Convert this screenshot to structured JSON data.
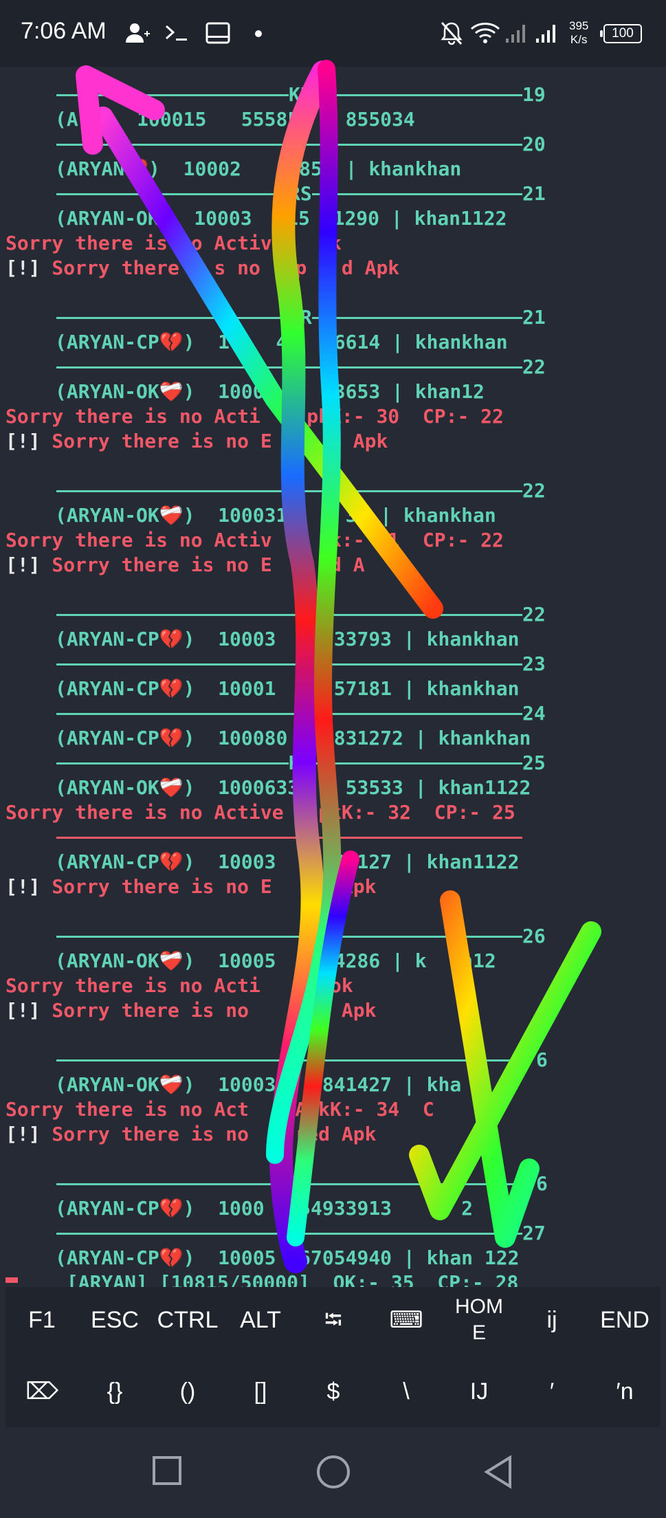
{
  "status_bar": {
    "time": "7:06 AM",
    "speed_value": "395",
    "speed_unit": "K/s",
    "battery": "100",
    "icons": [
      "person-add-icon",
      "terminal-icon",
      "screen-icon",
      "dot-icon",
      "bell-off-icon",
      "wifi-icon",
      "signal-icon",
      "signal-icon-2"
    ]
  },
  "terminal": {
    "rules": [
      {
        "label": "KR",
        "num": "19"
      },
      {
        "label": "",
        "num": "20"
      },
      {
        "label": "RS",
        "num": "21"
      },
      {
        "label": "KR",
        "num": "21"
      },
      {
        "label": "K",
        "num": "22"
      },
      {
        "label": "",
        "num": "22"
      },
      {
        "label": "",
        "num": "22"
      },
      {
        "label": "",
        "num": "23"
      },
      {
        "label": "",
        "num": "24"
      },
      {
        "label": "K",
        "num": "25"
      },
      {
        "label": "",
        "num": ""
      },
      {
        "label": "",
        "num": "26"
      },
      {
        "label": "",
        "num": "6"
      },
      {
        "label": "S",
        "num": "6"
      },
      {
        "label": "S",
        "num": "27"
      }
    ],
    "lines": [
      {
        "prefix": "(A",
        "status": "",
        "heart": "💔",
        "rest": ")  100015   555852 | 855034"
      },
      {
        "prefix": "(ARYAN",
        "status": "",
        "heart": "💔",
        "rest": ")  10002   49854 | khankhan"
      },
      {
        "prefix": "(ARYAN-OK",
        "status": "",
        "heart": "",
        "rest": ")  10003  815  1290 | khan1122"
      },
      {
        "text": "Sorry there is  o Active    k"
      },
      {
        "bracket": "[!]",
        "text": " Sorry there   s no  xp   d Apk"
      },
      {
        "prefix": "(ARYAN-CP",
        "heart": "💔",
        "rest": ")  1    42  16614 | khankhan"
      },
      {
        "prefix": "(ARYAN-OK",
        "heart": "❤️‍🩹",
        "rest": ")  10004     3653 | khan12"
      },
      {
        "text": "Sorry there is no Acti    pkK:- 30  CP:- 22"
      },
      {
        "bracket": "[!]",
        "text": " Sorry there is no E     d Apk"
      },
      {
        "prefix": "(ARYAN-OK",
        "heart": "❤️‍🩹",
        "rest": ")  100031     35 | khankhan"
      },
      {
        "text": "Sorry there is no Activ     k:- 31  CP:- 22"
      },
      {
        "bracket": "[!]",
        "text": " Sorry there is no E     d A"
      },
      {
        "prefix": "(ARYAN-CP",
        "heart": "💔",
        "rest": ")  10003     33793 | khankhan"
      },
      {
        "prefix": "(ARYAN-CP",
        "heart": "💔",
        "rest": ")  10001     57181 | khankhan"
      },
      {
        "prefix": "(ARYAN-CP",
        "heart": "💔",
        "rest": ")  100080    831272 | khankhan"
      },
      {
        "prefix": "(ARYAN-OK",
        "heart": "❤️‍🩹",
        "rest": ")  1000633    53533 | khan1122"
      },
      {
        "text": "Sorry there is no Active   pkK:- 32  CP:- 25"
      },
      {
        "prefix": "(ARYAN-CP",
        "heart": "💔",
        "rest": ")  10003    938127 | khan1122"
      },
      {
        "bracket": "[!]",
        "text": " Sorry there is no E      Apk"
      },
      {
        "prefix": "(ARYAN-OK",
        "heart": "❤️‍🩹",
        "rest": ")  10005     4286 | k   n12"
      },
      {
        "text": "Sorry there is no Acti      ok"
      },
      {
        "bracket": "[!]",
        "text": " Sorry there is no     ed Apk"
      },
      {
        "prefix": "(ARYAN-OK",
        "heart": "❤️‍🩹",
        "rest": ")  10003    841427 | kha   45"
      },
      {
        "text": "Sorry there is no Act    ApkK:- 34  C    26"
      },
      {
        "bracket": "[!]",
        "text": " Sorry there is no    red Apk"
      },
      {
        "prefix": "(ARYAN-CP",
        "heart": "💔",
        "rest": ")  1000   54933913      2"
      },
      {
        "prefix": "(ARYAN-CP",
        "heart": "💔",
        "rest": ")  10005  67054940 | khan 122"
      },
      {
        "text": " [ARYAN] [10815/50000]  OK:- 35  CP:- 28"
      }
    ]
  },
  "extra_keys": {
    "row1": [
      "F1",
      "ESC",
      "CTRL",
      "ALT",
      "⭾",
      "⌨",
      "HOME",
      "ij",
      "END"
    ],
    "row2": [
      "⌦",
      "{}",
      "()",
      "[]",
      "$",
      "\\",
      "IJ",
      "′",
      "′n"
    ]
  },
  "nav": [
    "recents-button",
    "home-button",
    "back-button"
  ]
}
